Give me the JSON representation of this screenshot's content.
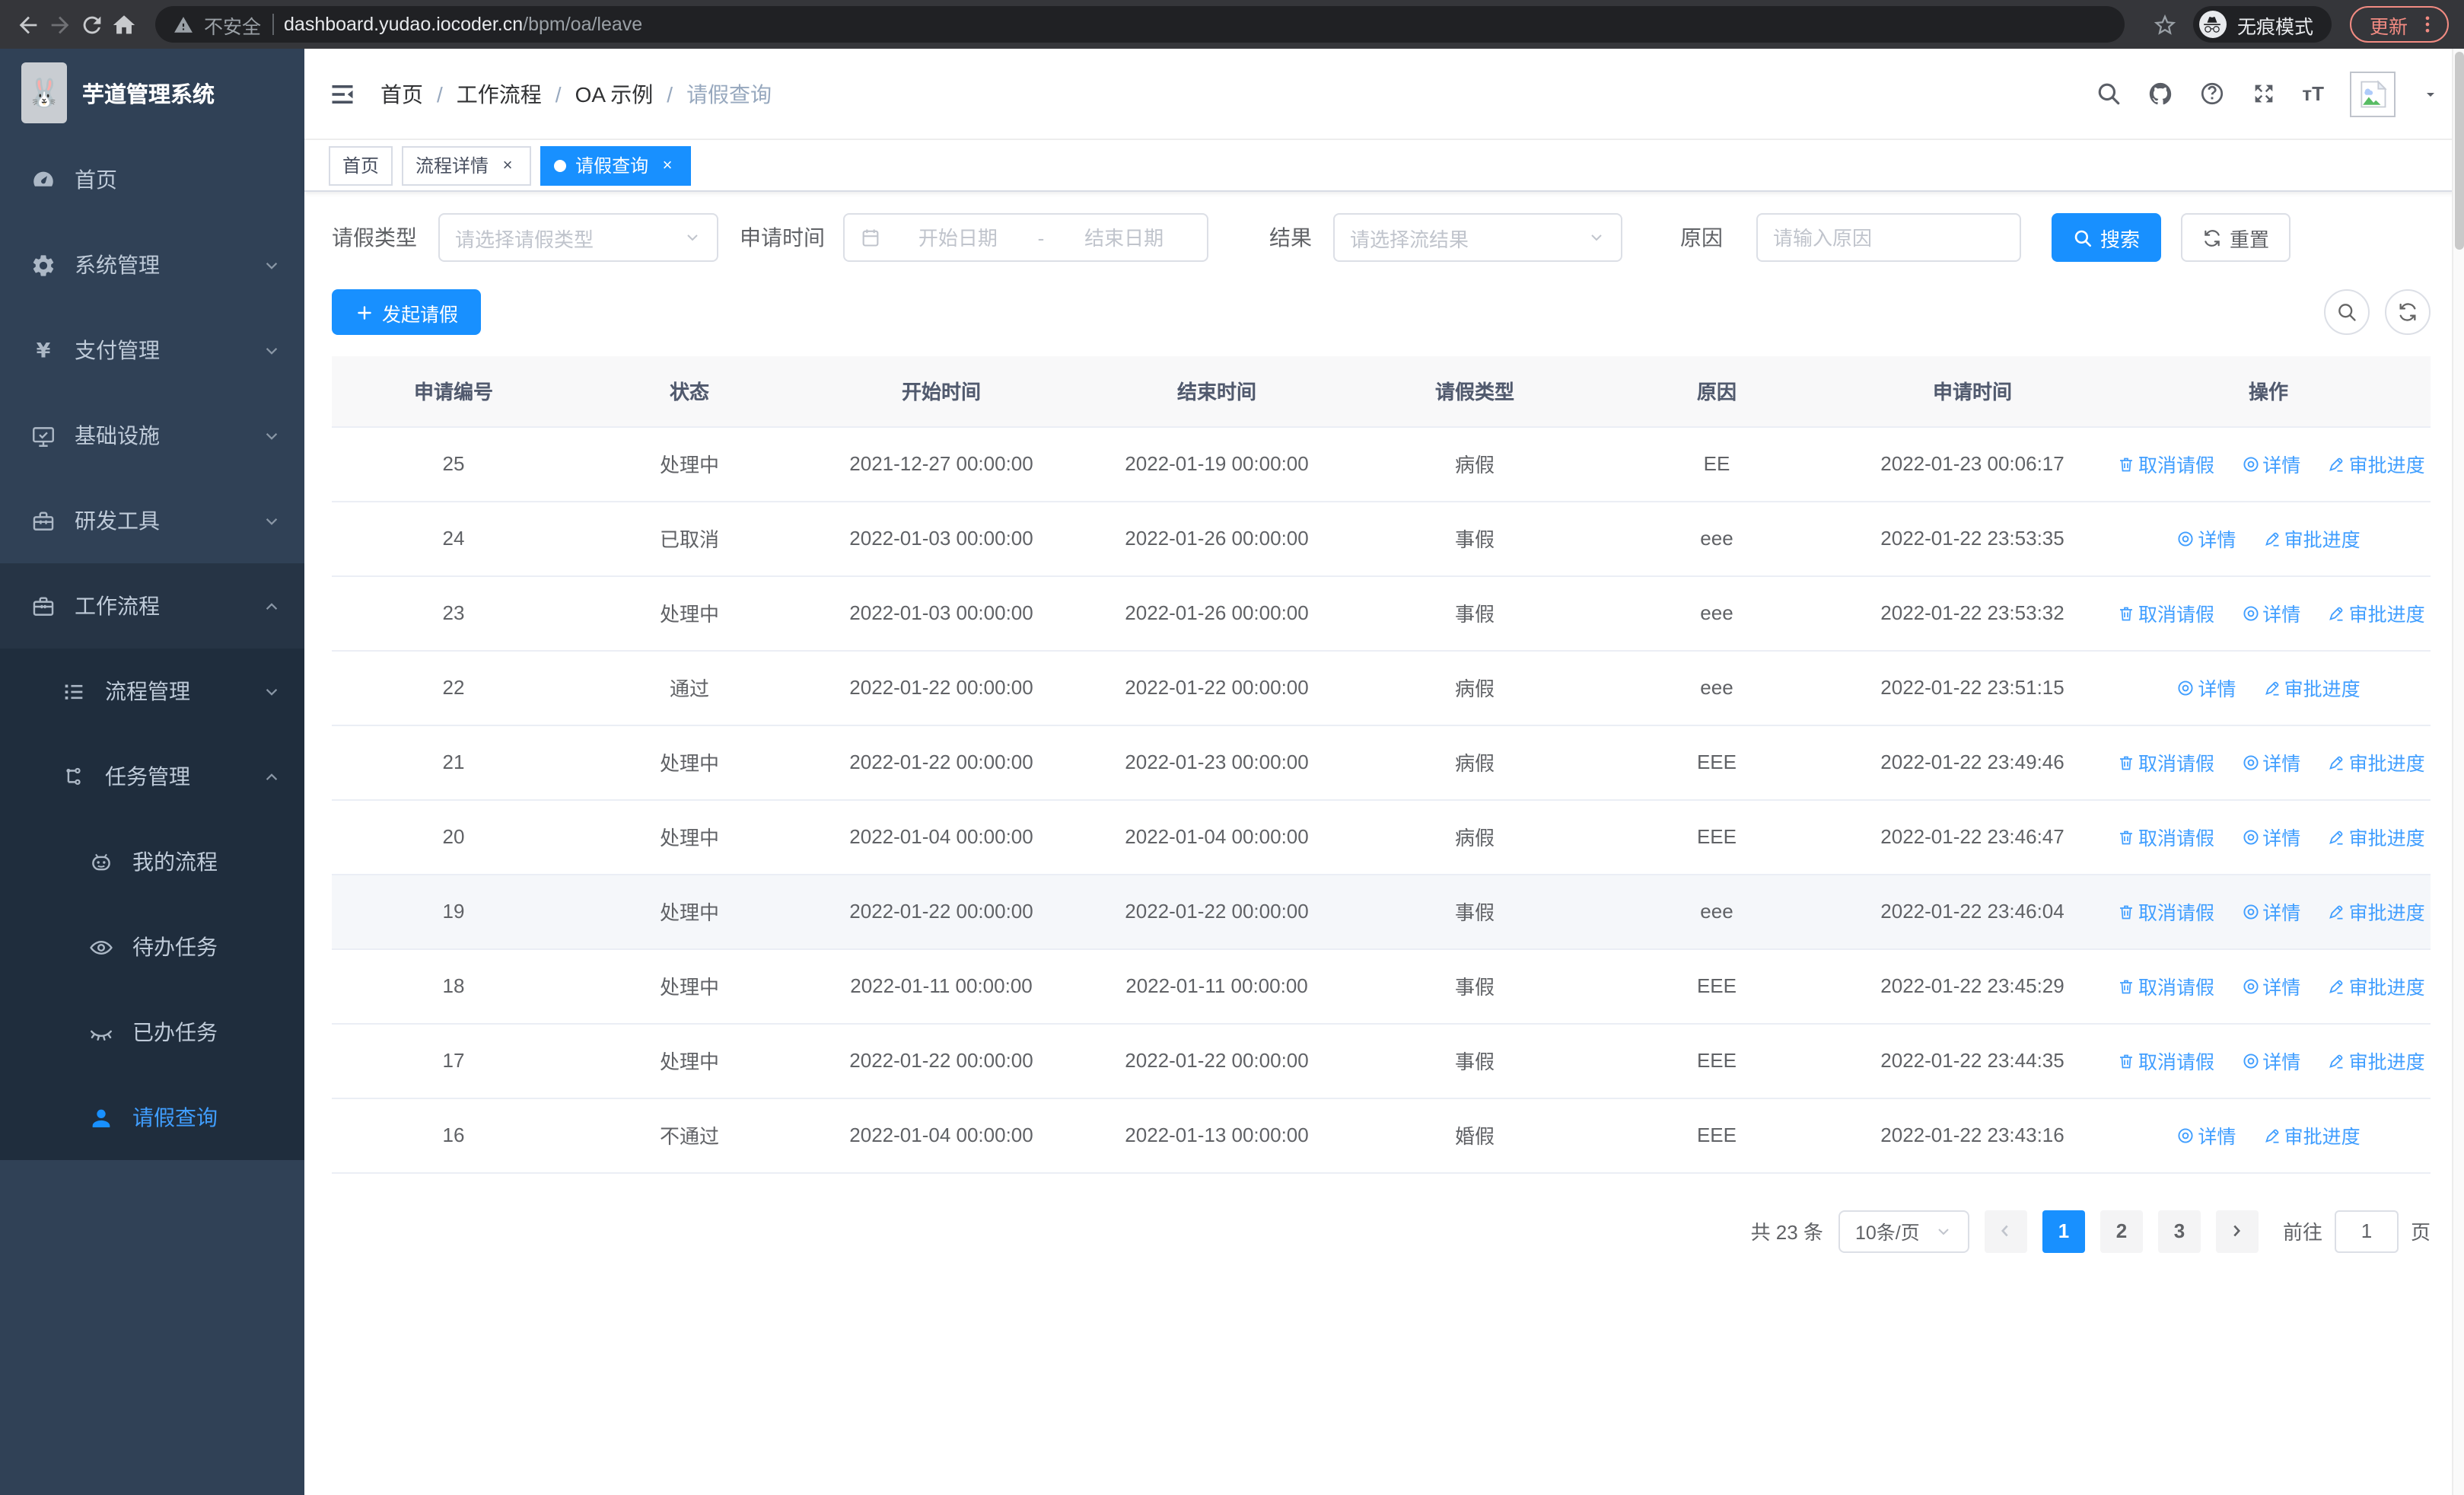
{
  "browser": {
    "security_label": "不安全",
    "url_host": "dashboard.yudao.iocoder.cn",
    "url_path": "/bpm/oa/leave",
    "incognito_label": "无痕模式",
    "update_label": "更新"
  },
  "sidebar": {
    "app_title": "芋道管理系统",
    "items": [
      {
        "label": "首页",
        "icon": "dashboard-icon",
        "level": 1
      },
      {
        "label": "系统管理",
        "icon": "gear-icon",
        "level": 1,
        "chevron": "down"
      },
      {
        "label": "支付管理",
        "icon": "yen-icon",
        "level": 1,
        "chevron": "down"
      },
      {
        "label": "基础设施",
        "icon": "monitor-icon",
        "level": 1,
        "chevron": "down"
      },
      {
        "label": "研发工具",
        "icon": "toolbox-icon",
        "level": 1,
        "chevron": "down"
      },
      {
        "label": "工作流程",
        "icon": "briefcase-icon",
        "level": 1,
        "chevron": "up",
        "active_parent": true
      },
      {
        "label": "流程管理",
        "icon": "list-tree-icon",
        "level": 2,
        "chevron": "down"
      },
      {
        "label": "任务管理",
        "icon": "flow-icon",
        "level": 2,
        "chevron": "up"
      },
      {
        "label": "我的流程",
        "icon": "robot-icon",
        "level": 3
      },
      {
        "label": "待办任务",
        "icon": "eye-open-icon",
        "level": 3
      },
      {
        "label": "已办任务",
        "icon": "eye-closed-icon",
        "level": 3
      },
      {
        "label": "请假查询",
        "icon": "user-icon",
        "level": 3,
        "active": true
      }
    ]
  },
  "navbar": {
    "breadcrumbs": [
      "首页",
      "工作流程",
      "OA 示例",
      "请假查询"
    ]
  },
  "tabs": [
    {
      "label": "首页",
      "closable": false,
      "active": false
    },
    {
      "label": "流程详情",
      "closable": true,
      "active": false
    },
    {
      "label": "请假查询",
      "closable": true,
      "active": true
    }
  ],
  "filters": {
    "leave_type": {
      "label": "请假类型",
      "placeholder": "请选择请假类型"
    },
    "apply_time": {
      "label": "申请时间",
      "start_placeholder": "开始日期",
      "separator": "-",
      "end_placeholder": "结束日期"
    },
    "result": {
      "label": "结果",
      "placeholder": "请选择流结果"
    },
    "reason": {
      "label": "原因",
      "placeholder": "请输入原因"
    },
    "search_label": "搜索",
    "reset_label": "重置"
  },
  "toolbar": {
    "create_label": "发起请假"
  },
  "table": {
    "columns": [
      "申请编号",
      "状态",
      "开始时间",
      "结束时间",
      "请假类型",
      "原因",
      "申请时间",
      "操作"
    ],
    "ops": {
      "cancel": "取消请假",
      "detail": "详情",
      "progress": "审批进度"
    },
    "rows": [
      {
        "id": "25",
        "status": "处理中",
        "start": "2021-12-27 00:00:00",
        "end": "2022-01-19 00:00:00",
        "type": "病假",
        "reason": "EE",
        "applied": "2022-01-23 00:06:17",
        "can_cancel": true,
        "hover": false
      },
      {
        "id": "24",
        "status": "已取消",
        "start": "2022-01-03 00:00:00",
        "end": "2022-01-26 00:00:00",
        "type": "事假",
        "reason": "eee",
        "applied": "2022-01-22 23:53:35",
        "can_cancel": false,
        "hover": false
      },
      {
        "id": "23",
        "status": "处理中",
        "start": "2022-01-03 00:00:00",
        "end": "2022-01-26 00:00:00",
        "type": "事假",
        "reason": "eee",
        "applied": "2022-01-22 23:53:32",
        "can_cancel": true,
        "hover": false
      },
      {
        "id": "22",
        "status": "通过",
        "start": "2022-01-22 00:00:00",
        "end": "2022-01-22 00:00:00",
        "type": "病假",
        "reason": "eee",
        "applied": "2022-01-22 23:51:15",
        "can_cancel": false,
        "hover": false
      },
      {
        "id": "21",
        "status": "处理中",
        "start": "2022-01-22 00:00:00",
        "end": "2022-01-23 00:00:00",
        "type": "病假",
        "reason": "EEE",
        "applied": "2022-01-22 23:49:46",
        "can_cancel": true,
        "hover": false
      },
      {
        "id": "20",
        "status": "处理中",
        "start": "2022-01-04 00:00:00",
        "end": "2022-01-04 00:00:00",
        "type": "病假",
        "reason": "EEE",
        "applied": "2022-01-22 23:46:47",
        "can_cancel": true,
        "hover": false
      },
      {
        "id": "19",
        "status": "处理中",
        "start": "2022-01-22 00:00:00",
        "end": "2022-01-22 00:00:00",
        "type": "事假",
        "reason": "eee",
        "applied": "2022-01-22 23:46:04",
        "can_cancel": true,
        "hover": true
      },
      {
        "id": "18",
        "status": "处理中",
        "start": "2022-01-11 00:00:00",
        "end": "2022-01-11 00:00:00",
        "type": "事假",
        "reason": "EEE",
        "applied": "2022-01-22 23:45:29",
        "can_cancel": true,
        "hover": false
      },
      {
        "id": "17",
        "status": "处理中",
        "start": "2022-01-22 00:00:00",
        "end": "2022-01-22 00:00:00",
        "type": "事假",
        "reason": "EEE",
        "applied": "2022-01-22 23:44:35",
        "can_cancel": true,
        "hover": false
      },
      {
        "id": "16",
        "status": "不通过",
        "start": "2022-01-04 00:00:00",
        "end": "2022-01-13 00:00:00",
        "type": "婚假",
        "reason": "EEE",
        "applied": "2022-01-22 23:43:16",
        "can_cancel": false,
        "hover": false
      }
    ]
  },
  "pagination": {
    "total_text": "共 23 条",
    "page_size": "10条/页",
    "pages": [
      "1",
      "2",
      "3"
    ],
    "active_page": "1",
    "goto_label": "前往",
    "goto_value": "1",
    "page_label": "页"
  },
  "colors": {
    "primary": "#1890ff",
    "link": "#409eff",
    "sidebar_bg": "#304156",
    "submenu_bg": "#1f2d3d",
    "update_badge": "#f28b82"
  }
}
